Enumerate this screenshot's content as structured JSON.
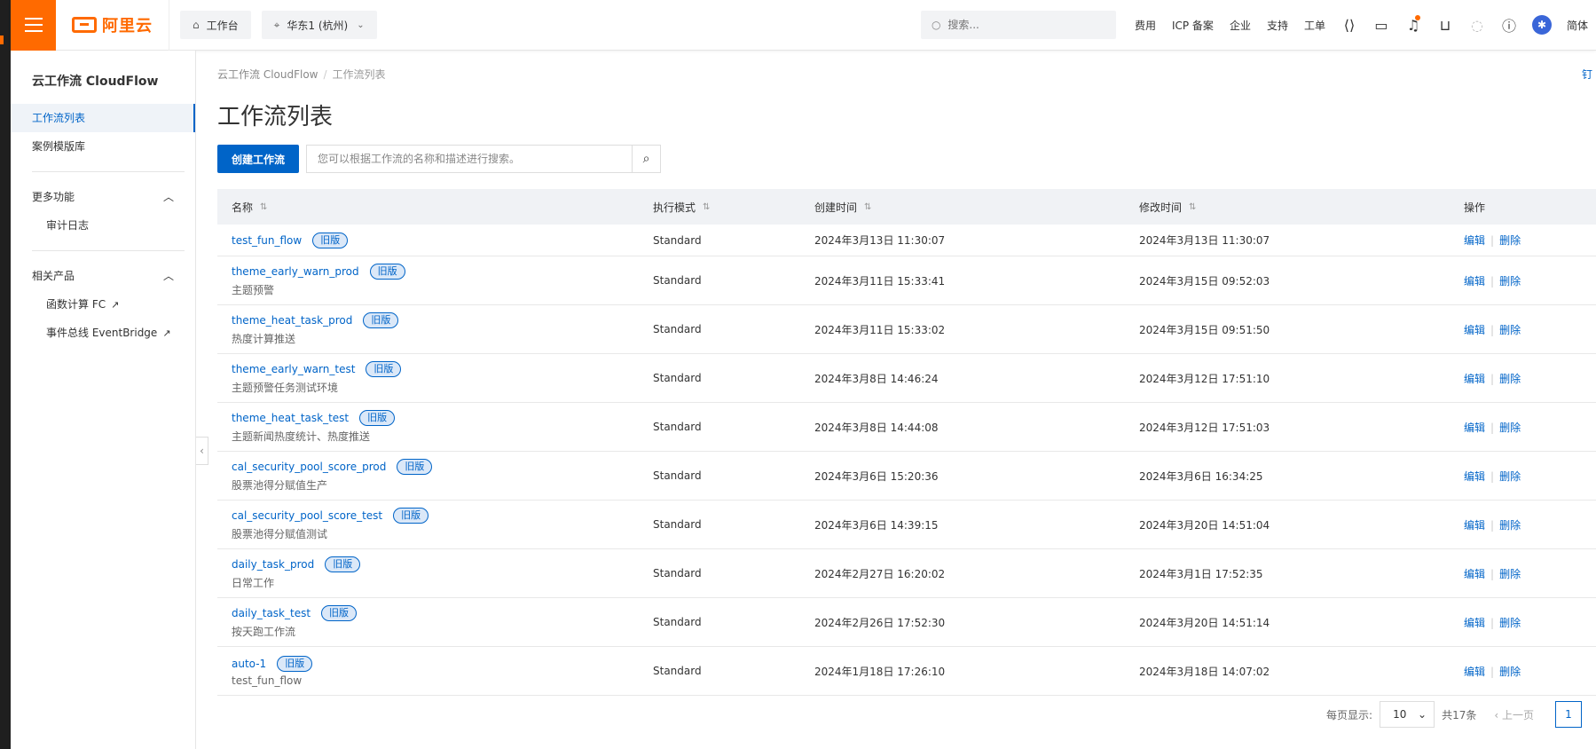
{
  "topbar": {
    "brand": "阿里云",
    "workbench": "工作台",
    "region": "华东1 (杭州)",
    "search_placeholder": "搜索...",
    "links": [
      "费用",
      "ICP 备案",
      "企业",
      "支持",
      "工单"
    ],
    "lang": "简体",
    "brand_color": "#ff6a00"
  },
  "sidebar": {
    "title": "云工作流 CloudFlow",
    "items": [
      {
        "label": "工作流列表"
      },
      {
        "label": "案例模版库"
      }
    ],
    "more": {
      "label": "更多功能",
      "sub": [
        "审计日志"
      ]
    },
    "related": {
      "label": "相关产品",
      "sub": [
        "函数计算 FC",
        "事件总线 EventBridge"
      ]
    }
  },
  "main": {
    "breadcrumb": [
      "云工作流 CloudFlow",
      "工作流列表"
    ],
    "right_mark": "钉",
    "title": "工作流列表",
    "create_btn": "创建工作流",
    "search_placeholder": "您可以根据工作流的名称和描述进行搜索。",
    "columns": [
      "名称",
      "执行模式",
      "创建时间",
      "修改时间",
      "操作"
    ],
    "tag_label": "旧版",
    "actions": {
      "edit": "编辑",
      "delete": "删除"
    },
    "rows": [
      {
        "name": "test_fun_flow",
        "desc": "",
        "mode": "Standard",
        "created": "2024年3月13日 11:30:07",
        "modified": "2024年3月13日 11:30:07"
      },
      {
        "name": "theme_early_warn_prod",
        "desc": "主题预警",
        "mode": "Standard",
        "created": "2024年3月11日 15:33:41",
        "modified": "2024年3月15日 09:52:03"
      },
      {
        "name": "theme_heat_task_prod",
        "desc": "热度计算推送",
        "mode": "Standard",
        "created": "2024年3月11日 15:33:02",
        "modified": "2024年3月15日 09:51:50"
      },
      {
        "name": "theme_early_warn_test",
        "desc": "主题预警任务测试环境",
        "mode": "Standard",
        "created": "2024年3月8日 14:46:24",
        "modified": "2024年3月12日 17:51:10"
      },
      {
        "name": "theme_heat_task_test",
        "desc": "主题新闻热度统计、热度推送",
        "mode": "Standard",
        "created": "2024年3月8日 14:44:08",
        "modified": "2024年3月12日 17:51:03"
      },
      {
        "name": "cal_security_pool_score_prod",
        "desc": "股票池得分赋值生产",
        "mode": "Standard",
        "created": "2024年3月6日 15:20:36",
        "modified": "2024年3月6日 16:34:25"
      },
      {
        "name": "cal_security_pool_score_test",
        "desc": "股票池得分赋值测试",
        "mode": "Standard",
        "created": "2024年3月6日 14:39:15",
        "modified": "2024年3月20日 14:51:04"
      },
      {
        "name": "daily_task_prod",
        "desc": "日常工作",
        "mode": "Standard",
        "created": "2024年2月27日 16:20:02",
        "modified": "2024年3月1日 17:52:35"
      },
      {
        "name": "daily_task_test",
        "desc": "按天跑工作流",
        "mode": "Standard",
        "created": "2024年2月26日 17:52:30",
        "modified": "2024年3月20日 14:51:14"
      },
      {
        "name": "auto-1",
        "desc": "test_fun_flow",
        "mode": "Standard",
        "created": "2024年1月18日 17:26:10",
        "modified": "2024年3月18日 14:07:02"
      }
    ],
    "pager": {
      "per_page_label": "每页显示:",
      "per_page": "10",
      "total": "共17条",
      "prev": "上一页",
      "page": "1"
    }
  }
}
